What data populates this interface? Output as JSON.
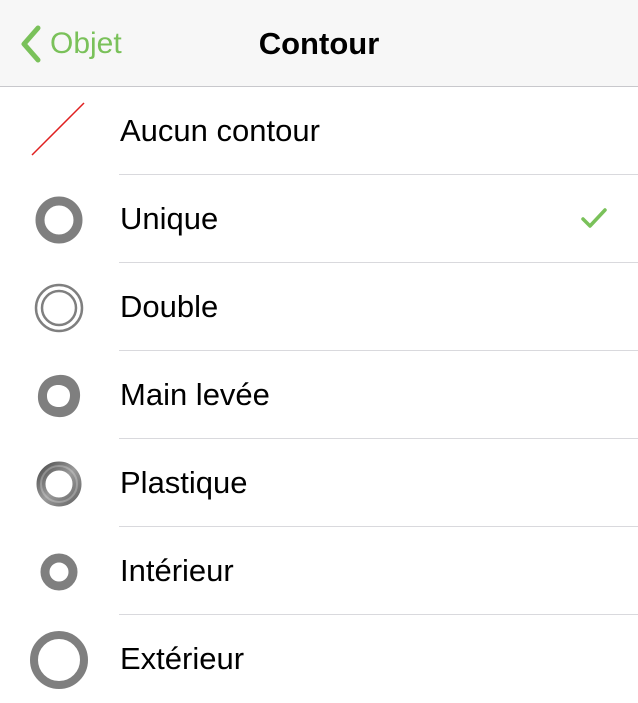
{
  "nav": {
    "back_label": "Objet",
    "title": "Contour"
  },
  "colors": {
    "accent": "#7ac15a",
    "icon_gray": "#7f7f7f",
    "none_line": "#e02020"
  },
  "options": [
    {
      "label": "Aucun contour",
      "icon": "no-stroke-icon",
      "selected": false
    },
    {
      "label": "Unique",
      "icon": "single-stroke-icon",
      "selected": true
    },
    {
      "label": "Double",
      "icon": "double-stroke-icon",
      "selected": false
    },
    {
      "label": "Main levée",
      "icon": "freehand-stroke-icon",
      "selected": false
    },
    {
      "label": "Plastique",
      "icon": "plastic-stroke-icon",
      "selected": false
    },
    {
      "label": "Intérieur",
      "icon": "inner-stroke-icon",
      "selected": false
    },
    {
      "label": "Extérieur",
      "icon": "outer-stroke-icon",
      "selected": false
    }
  ]
}
